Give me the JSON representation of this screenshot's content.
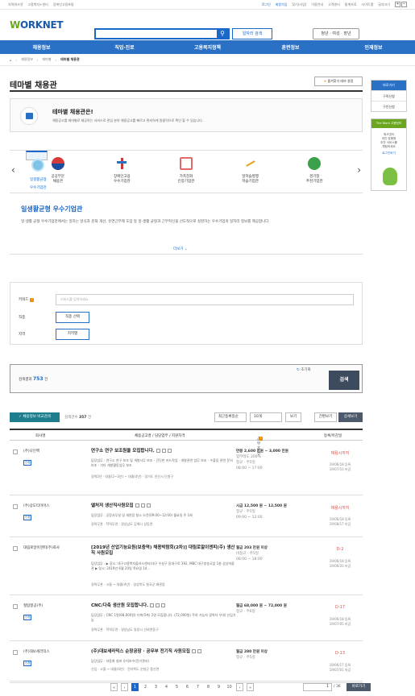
{
  "topbar": {
    "left": [
      "지역워크넷",
      "고용복지+센터",
      "장애인고용포털"
    ],
    "right": [
      "로그인",
      "회원가입",
      "찾기(사업)",
      "이용안내",
      "고객센터",
      "통계자료",
      "사이트맵",
      "글자크기"
    ]
  },
  "header": {
    "logo_prefix": "W",
    "logo_rest": "ORKNET",
    "search_icon": "search-icon",
    "job_search_label": "일자리 검색",
    "tags_label": "청년 · 여성 · 장년"
  },
  "gnb": [
    "채용정보",
    "직업·진로",
    "고용복지정책",
    "훈련정보",
    "인재정보"
  ],
  "breadcrumb": [
    "홈",
    "채용정보",
    "테마별",
    "테마별 채용관"
  ],
  "page": {
    "title": "테마별 채용관",
    "fav_label": "즐겨찾기 테마 설정",
    "intro_title": "테마별 채용관은!",
    "intro_desc": "채용공고를 테마별로 제공하는 서비스로 관심 분야 채용공고를 빠르고 편리하게 원클릭으로 확인 할 수 있습니다."
  },
  "categories": [
    {
      "line1": "일생활균형",
      "line2": "우수기업관"
    },
    {
      "line1": "공공부문",
      "line2": "채용관"
    },
    {
      "line1": "장애인고용",
      "line2": "우수기업관"
    },
    {
      "line1": "가족친화",
      "line2": "인증기업관"
    },
    {
      "line1": "일학습병행",
      "line2": "학습기업관"
    },
    {
      "line1": "경기청",
      "line2": "추천기업관"
    }
  ],
  "detail": {
    "title": "일생활균형 우수기업관",
    "desc": "일·생활 균형 우수기업관에서는 일하는 방식과 문화 개선, 유연근무제 도입 등 일·생활 균형과 근무혁신을 선도적으로 실천하는 우수기업의 일자리 정보를 제공합니다.",
    "more": "더보기"
  },
  "filter": {
    "keyword_label": "키워드",
    "keyword_placeholder": "키워드를 입력하세요.",
    "job_label": "직종",
    "job_btn": "직종 선택",
    "region_label": "지역",
    "region_btn": "지역별"
  },
  "result": {
    "prefix": "검색결과",
    "count": "753",
    "suffix": "건",
    "reset": "초기화",
    "search_btn": "검색"
  },
  "toolbar": {
    "compare_btn": "채용정보 비교검색",
    "selected_prefix": "검색건수",
    "selected_count": "357",
    "selected_suffix": "건",
    "sort": "최근등록일순",
    "per_page": "10개",
    "view_btn": "보기",
    "simple_btn": "간편보기",
    "detail_btn": "상세보기"
  },
  "table_headers": [
    "회사명",
    "채용공고명 / 담당업무 / 지원자격",
    "근무조건",
    "등록/마감일"
  ],
  "jobs": [
    {
      "company": "(주)나인핵",
      "badge": "인증",
      "title": "연구소 연구 보조원을 모집합니다.",
      "desc": "담당업무 : 연구소 연구 보조 및 개발사무 보조 - 간단한 카드작업 - 개발관련 업무 보조 - 수출입 관련 문서 보조 - 기타 개발활동업무 보조",
      "meta": "경력2년 · 대졸(2~3년) ~ 대졸(4년) · 경기도 안산시 단원구",
      "salary": "연봉 2,600 만원 ~ 3,000 만원",
      "extra": "업무테도 200%",
      "type": "정규 · 주5일",
      "hours": "08:00 ~ 17:00",
      "status": "채용시까지",
      "reg": "19/06/18 등록",
      "end": "19/07/10 마감"
    },
    {
      "company": "(주)상도티미어스",
      "badge": "인증",
      "title": "엘처저 생산직사원모집",
      "desc": "담당업무 : 공장사무실 및 세연장 청소 오전(09:00~12:00) 월요일 주 1회",
      "meta": "경력무관 · 학력무관 · 경상남도 김해시 상동면",
      "salary": "시급 12,500 원 ~ 12,500 원",
      "extra": "",
      "type": "정규 · 주5일",
      "hours": "09:00 ~ 12:00",
      "status": "채용시까지",
      "reg": "19/06/18 등록",
      "end": "19/08/17 마감"
    },
    {
      "company": "대림로알이엔피(주)회사",
      "badge": "",
      "title": "[2019년 산업기능요원(보충역) 채용박람회(2차)] 대림로알이엔피(주) 생산직 사원모집",
      "desc": "담당업무 : ▶ 장소: 대구고용복지플러스센터(대구 수성구 동대구로 392, MBC 대구방송국앞 1층 상상마을관 ▶ 일시: 2019년 6월 20일 목요일 14...",
      "meta": "경력무관 · 고졸 ~ 대졸(4년) · 경상북도 칠곡군 왜관읍",
      "salary": "월급 203 만원 이상",
      "extra": "",
      "type": "비정규 · 주5일",
      "hours": "08:00 ~ 18:00",
      "status": "D-2",
      "reg": "19/06/18 등록",
      "end": "19/06/20 마감"
    },
    {
      "company": "철탑항공(주)",
      "badge": "인증",
      "title": "CNC/다축 생산원 모집합니다.",
      "desc": "담당업무 : CNC 1명(68,000원) 다축(5축) 2명 모집합니다. (72,000원) 주야 가능자 경력자 우대/ 신입가능",
      "meta": "경력무관 · 학력무관 · 경상남도 밀양시 산외면동구",
      "salary": "월급 68,000 원 ~ 72,000 원",
      "extra": "",
      "type": "정규 · 주6일",
      "hours": "",
      "status": "D-17",
      "reg": "19/06/18 등록",
      "end": "19/07/05 마감"
    },
    {
      "company": "(주)대보세라믹스",
      "badge": "인증",
      "title": "(주)대보세라믹스 순창공장 · 공무부 전기직 사원모집",
      "desc": "담당업무 : 자동화 설비 유지보수(전기관리)",
      "meta": "신입 · 고졸 ~ 대졸(4년) · 전라북도 순창군 풍산면",
      "salary": "월급 280 만원 이상",
      "extra": "",
      "type": "정규 · 주5일",
      "hours": "",
      "status": "D-13",
      "reg": "19/06/17 등록",
      "end": "19/07/01 마감"
    }
  ],
  "pagination": {
    "pages": [
      "1",
      "2",
      "3",
      "4",
      "5",
      "6",
      "7",
      "8",
      "9",
      "10"
    ],
    "current": "1",
    "input_value": "1",
    "total": "/ 36",
    "go_btn": "바로가기"
  },
  "side": {
    "head": "바로가기",
    "items": [
      "구직신청",
      "구인신청"
    ],
    "banner_head": "The Work 고용정보",
    "banner_lines": [
      "워크넷의",
      "개인 맞춤형",
      "추천 서비스를",
      "체험하세요"
    ],
    "banner_link": "로그인하기"
  },
  "colors": {
    "accent": "#2a70c4",
    "compare": "#1f7e8e",
    "deadline": "#d9534f"
  }
}
